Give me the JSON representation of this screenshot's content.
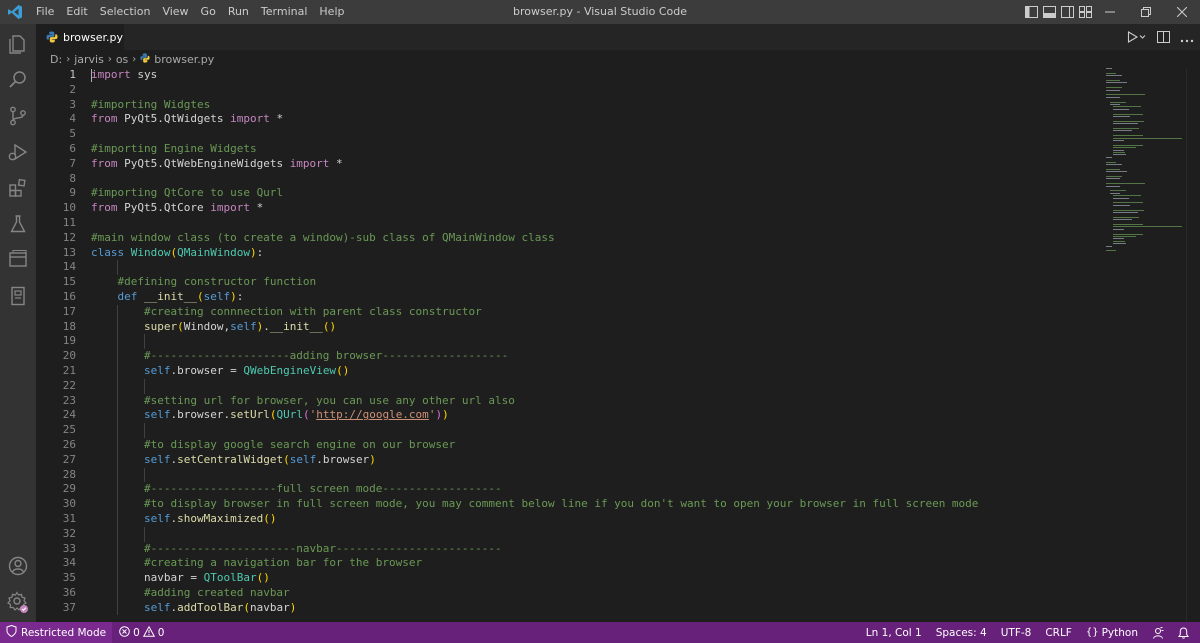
{
  "titlebar": {
    "menu": [
      "File",
      "Edit",
      "Selection",
      "View",
      "Go",
      "Run",
      "Terminal",
      "Help"
    ],
    "window_title": "browser.py - Visual Studio Code"
  },
  "activity_bar": {
    "items": [
      "explorer-icon",
      "search-icon",
      "source-control-icon",
      "run-debug-icon",
      "extensions-icon",
      "testing-icon",
      "remote-explorer-icon",
      "notebook-icon"
    ],
    "bottom": [
      "account-icon",
      "manage-gear-icon"
    ]
  },
  "tab": {
    "label": "browser.py"
  },
  "breadcrumb": {
    "parts": [
      "D:",
      "jarvis",
      "os",
      "browser.py"
    ]
  },
  "editor": {
    "lines": [
      {
        "n": "1",
        "code": "import sys"
      },
      {
        "n": "2",
        "code": ""
      },
      {
        "n": "3",
        "code": "#importing Widgtes"
      },
      {
        "n": "4",
        "code": "from PyQt5.QtWidgets import *"
      },
      {
        "n": "5",
        "code": ""
      },
      {
        "n": "6",
        "code": "#importing Engine Widgets"
      },
      {
        "n": "7",
        "code": "from PyQt5.QtWebEngineWidgets import *"
      },
      {
        "n": "8",
        "code": ""
      },
      {
        "n": "9",
        "code": "#importing QtCore to use Qurl"
      },
      {
        "n": "10",
        "code": "from PyQt5.QtCore import *"
      },
      {
        "n": "11",
        "code": ""
      },
      {
        "n": "12",
        "code": "#main window class (to create a window)-sub class of QMainWindow class"
      },
      {
        "n": "13",
        "code": "class Window(QMainWindow):"
      },
      {
        "n": "14",
        "code": ""
      },
      {
        "n": "15",
        "code": "    #defining constructor function"
      },
      {
        "n": "16",
        "code": "    def __init__(self):"
      },
      {
        "n": "17",
        "code": "        #creating connnection with parent class constructor"
      },
      {
        "n": "18",
        "code": "        super(Window,self).__init__()"
      },
      {
        "n": "19",
        "code": ""
      },
      {
        "n": "20",
        "code": "        #---------------------adding browser-------------------"
      },
      {
        "n": "21",
        "code": "        self.browser = QWebEngineView()"
      },
      {
        "n": "22",
        "code": ""
      },
      {
        "n": "23",
        "code": "        #setting url for browser, you can use any other url also"
      },
      {
        "n": "24",
        "code": "        self.browser.setUrl(QUrl('http://google.com'))"
      },
      {
        "n": "25",
        "code": ""
      },
      {
        "n": "26",
        "code": "        #to display google search engine on our browser"
      },
      {
        "n": "27",
        "code": "        self.setCentralWidget(self.browser)"
      },
      {
        "n": "28",
        "code": ""
      },
      {
        "n": "29",
        "code": "        #-------------------full screen mode------------------"
      },
      {
        "n": "30",
        "code": "        #to display browser in full screen mode, you may comment below line if you don't want to open your browser in full screen mode"
      },
      {
        "n": "31",
        "code": "        self.showMaximized()"
      },
      {
        "n": "32",
        "code": ""
      },
      {
        "n": "33",
        "code": "        #----------------------navbar-------------------------"
      },
      {
        "n": "34",
        "code": "        #creating a navigation bar for the browser"
      },
      {
        "n": "35",
        "code": "        navbar = QToolBar()"
      },
      {
        "n": "36",
        "code": "        #adding created navbar"
      },
      {
        "n": "37",
        "code": "        self.addToolBar(navbar)"
      }
    ]
  },
  "statusbar": {
    "restricted": "Restricted Mode",
    "errors": "0",
    "warnings": "0",
    "position": "Ln 1, Col 1",
    "spaces": "Spaces: 4",
    "encoding": "UTF-8",
    "eol": "CRLF",
    "language": "Python"
  },
  "colors": {
    "statusbar": "#68217a",
    "editor_bg": "#1e1e1e",
    "activitybar": "#333333",
    "titlebar": "#3c3c3c",
    "vscode_blue": "#3c9cd7"
  }
}
